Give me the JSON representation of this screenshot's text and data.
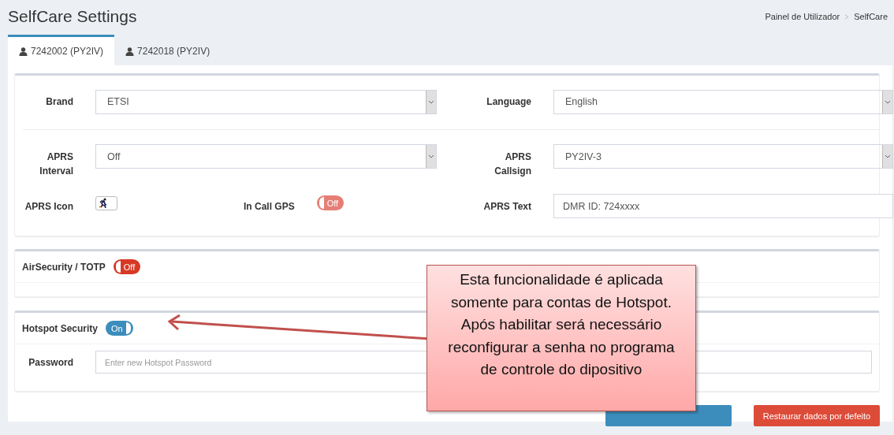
{
  "page_title": "SelfCare Settings",
  "breadcrumb": [
    "Painel de Utilizador",
    "SelfCare"
  ],
  "tabs": [
    {
      "label": "7242002 (PY2IV)",
      "selected": true
    },
    {
      "label": "7242018 (PY2IV)",
      "selected": false
    }
  ],
  "settings": {
    "brand": {
      "label": "Brand",
      "value": "ETSI"
    },
    "language": {
      "label": "Language",
      "value": "English"
    },
    "aprs_interval": {
      "label": "APRS Interval",
      "value": "Off"
    },
    "aprs_callsign": {
      "label": "APRS Callsign",
      "value": "PY2IV-3"
    },
    "aprs_icon": {
      "label": "APRS Icon"
    },
    "in_call_gps": {
      "label": "In Call GPS",
      "on": false,
      "toggle_text": "Off"
    },
    "aprs_text": {
      "label": "APRS Text",
      "value": "DMR ID: 724xxxx"
    }
  },
  "air_security": {
    "label": "AirSecurity / TOTP",
    "on": false,
    "toggle_text": "Off"
  },
  "hotspot_security": {
    "label": "Hotspot Security",
    "on": true,
    "toggle_text": "On",
    "password_label": "Password",
    "password_placeholder": "Enter new Hotspot Password"
  },
  "restore_button": "Restaurar dados por defeito",
  "callout": "Esta funcionalidade é aplicada somente para contas de Hotspot. Após habilitar será necessário reconfigurar a senha no programa de controle do dipositivo"
}
